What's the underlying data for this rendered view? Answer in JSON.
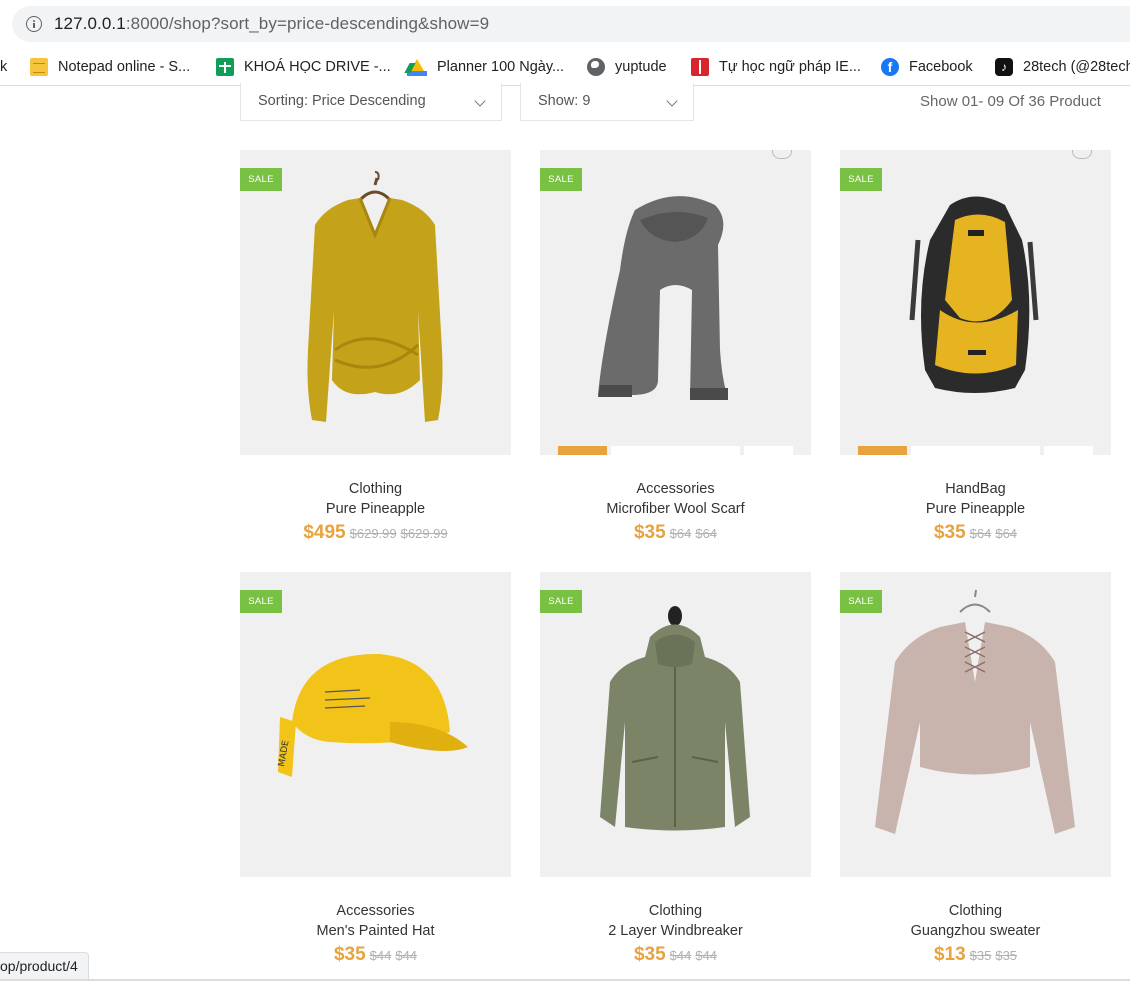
{
  "browser": {
    "url_host": "127.0.0.1",
    "url_rest": ":8000/shop?sort_by=price-descending&show=9",
    "bookmarks": [
      {
        "label": "k",
        "icon": "none"
      },
      {
        "label": "Notepad online - S...",
        "icon": "notepad-icon"
      },
      {
        "label": "KHOÁ HỌC DRIVE -...",
        "icon": "sheets-icon"
      },
      {
        "label": "Planner 100 Ngày...",
        "icon": "drive-icon"
      },
      {
        "label": "yuptude",
        "icon": "globe-icon"
      },
      {
        "label": "Tự học ngữ pháp IE...",
        "icon": "book-icon"
      },
      {
        "label": "Facebook",
        "icon": "facebook-icon"
      },
      {
        "label": "28tech (@28tech",
        "icon": "tiktok-icon"
      }
    ],
    "status_url": "op/product/4"
  },
  "toolbar": {
    "sorting_label": "Sorting: Price Descending",
    "show_label": "Show: 9",
    "result_text": "Show 01- 09 Of 36 Product"
  },
  "products": [
    {
      "category": "Clothing",
      "name": "Pure Pineapple",
      "price": "$495",
      "old_price_1": "$629.99",
      "old_price_2": "$629.99",
      "badge": "SALE",
      "image": "yellow-sweater-image"
    },
    {
      "category": "Accessories",
      "name": "Microfiber Wool Scarf",
      "price": "$35",
      "old_price_1": "$64",
      "old_price_2": "$64",
      "badge": "SALE",
      "image": "grey-scarf-image"
    },
    {
      "category": "HandBag",
      "name": "Pure Pineapple",
      "price": "$35",
      "old_price_1": "$64",
      "old_price_2": "$64",
      "badge": "SALE",
      "image": "yellow-backpack-image"
    },
    {
      "category": "Accessories",
      "name": "Men's Painted Hat",
      "price": "$35",
      "old_price_1": "$44",
      "old_price_2": "$44",
      "badge": "SALE",
      "image": "yellow-cap-image"
    },
    {
      "category": "Clothing",
      "name": "2 Layer Windbreaker",
      "price": "$35",
      "old_price_1": "$44",
      "old_price_2": "$44",
      "badge": "SALE",
      "image": "green-jacket-image"
    },
    {
      "category": "Clothing",
      "name": "Guangzhou sweater",
      "price": "$13",
      "old_price_1": "$35",
      "old_price_2": "$35",
      "badge": "SALE",
      "image": "pink-sweater-image"
    }
  ],
  "colors": {
    "sale_badge": "#79c143",
    "price": "#e8a23e",
    "card_bg": "#f0f0f0"
  }
}
